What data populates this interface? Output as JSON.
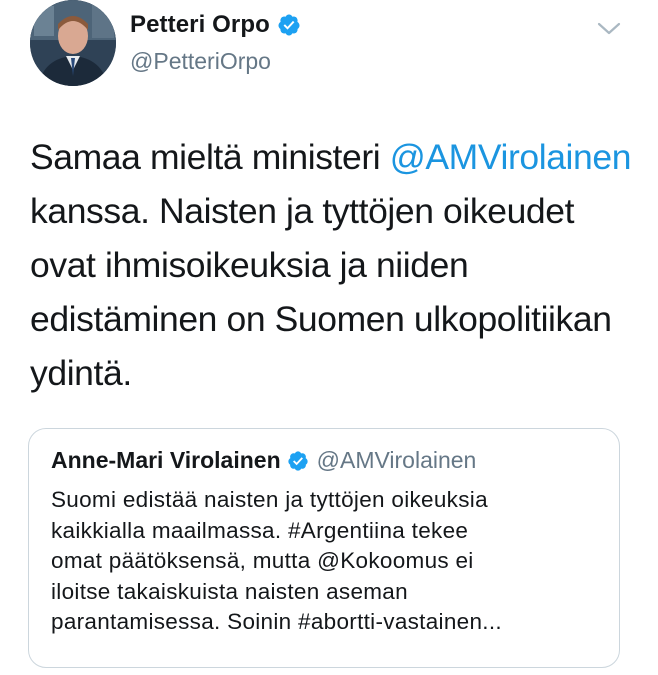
{
  "author": {
    "display_name": "Petteri Orpo",
    "handle": "@PetteriOrpo",
    "verified_icon": "verified-badge-icon",
    "avatar_icon": "profile-photo"
  },
  "menu_icon": "chevron-down-icon",
  "tweet_text": {
    "line1_pre": "Samaa mieltä ministeri ",
    "line1_mention": "@AMVirolainen",
    "line2": "kanssa. Naisten ja tyttöjen oikeudet",
    "line3": "ovat ihmisoikeuksia ja niiden",
    "line4": "edistäminen on Suomen ulkopolitiikan",
    "line5": "ydintä."
  },
  "quoted_tweet": {
    "display_name": "Anne-Mari Virolainen",
    "handle": "@AMVirolainen",
    "lines": [
      "Suomi edistää naisten ja tyttöjen oikeuksia",
      "kaikkialla maailmassa. #Argentiina tekee",
      "omat päätöksensä, mutta @Kokoomus ei",
      "iloitse takaiskuista naisten aseman",
      "parantamisessa. Soinin #abortti-vastainen..."
    ]
  },
  "colors": {
    "link": "#1b95e0",
    "verified": "#1da1f2",
    "secondary_text": "#657786",
    "border": "#ccd6dd"
  }
}
